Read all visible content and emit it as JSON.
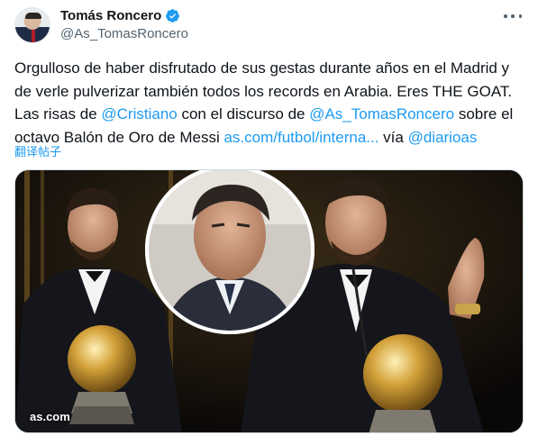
{
  "author": {
    "name": "Tomás Roncero",
    "handle": "@As_TomasRoncero",
    "verified": true,
    "avatar_icon": "profile-photo",
    "verified_icon": "verified-badge-icon",
    "more_icon": "more-options-icon"
  },
  "tweet": {
    "text_part1": "Orgulloso de haber disfrutado de sus gestas durante años en el Madrid y de verle pulverizar también todos los records en Arabia. Eres THE GOAT. Las risas de ",
    "mention1": "@Cristiano",
    "text_part2": " con el discurso de ",
    "mention2": "@As_TomasRoncero",
    "text_part3": " sobre el octavo Balón de Oro de Messi ",
    "link": "as.com/futbol/interna...",
    "text_part4": " vía ",
    "mention3": "@diarioas",
    "translate_label": "翻译帖子"
  },
  "media": {
    "watermark": "as.com"
  },
  "colors": {
    "link": "#1d9bf0",
    "text": "#0f1419",
    "secondary": "#536471",
    "verified": "#1d9bf0"
  }
}
